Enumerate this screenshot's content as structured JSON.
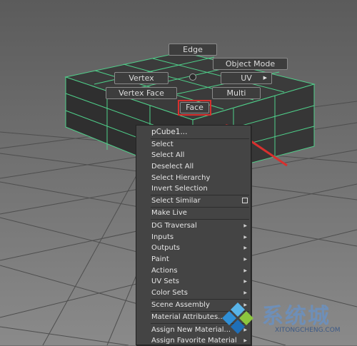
{
  "marking_menu": {
    "edge": "Edge",
    "object_mode": "Object Mode",
    "vertex": "Vertex",
    "uv": "UV",
    "vertex_face": "Vertex Face",
    "multi": "Multi",
    "face": "Face"
  },
  "context_menu": {
    "header": "pCube1...",
    "select": "Select",
    "select_all": "Select All",
    "deselect_all": "Deselect All",
    "select_hierarchy": "Select Hierarchy",
    "invert_selection": "Invert Selection",
    "select_similar": "Select Similar",
    "make_live": "Make Live",
    "dg_traversal": "DG Traversal",
    "inputs": "Inputs",
    "outputs": "Outputs",
    "paint": "Paint",
    "actions": "Actions",
    "uv_sets": "UV Sets",
    "color_sets": "Color Sets",
    "scene_assembly": "Scene Assembly",
    "material_attributes": "Material Attributes...",
    "assign_new_material": "Assign New Material...",
    "assign_favorite_material": "Assign Favorite Material"
  },
  "watermark": {
    "title": "系统城",
    "url": "XITONGCHENG.COM"
  },
  "colors": {
    "mesh_edges": "#4fd08a",
    "highlight": "#d8302e",
    "background": "#6f6f6f"
  }
}
